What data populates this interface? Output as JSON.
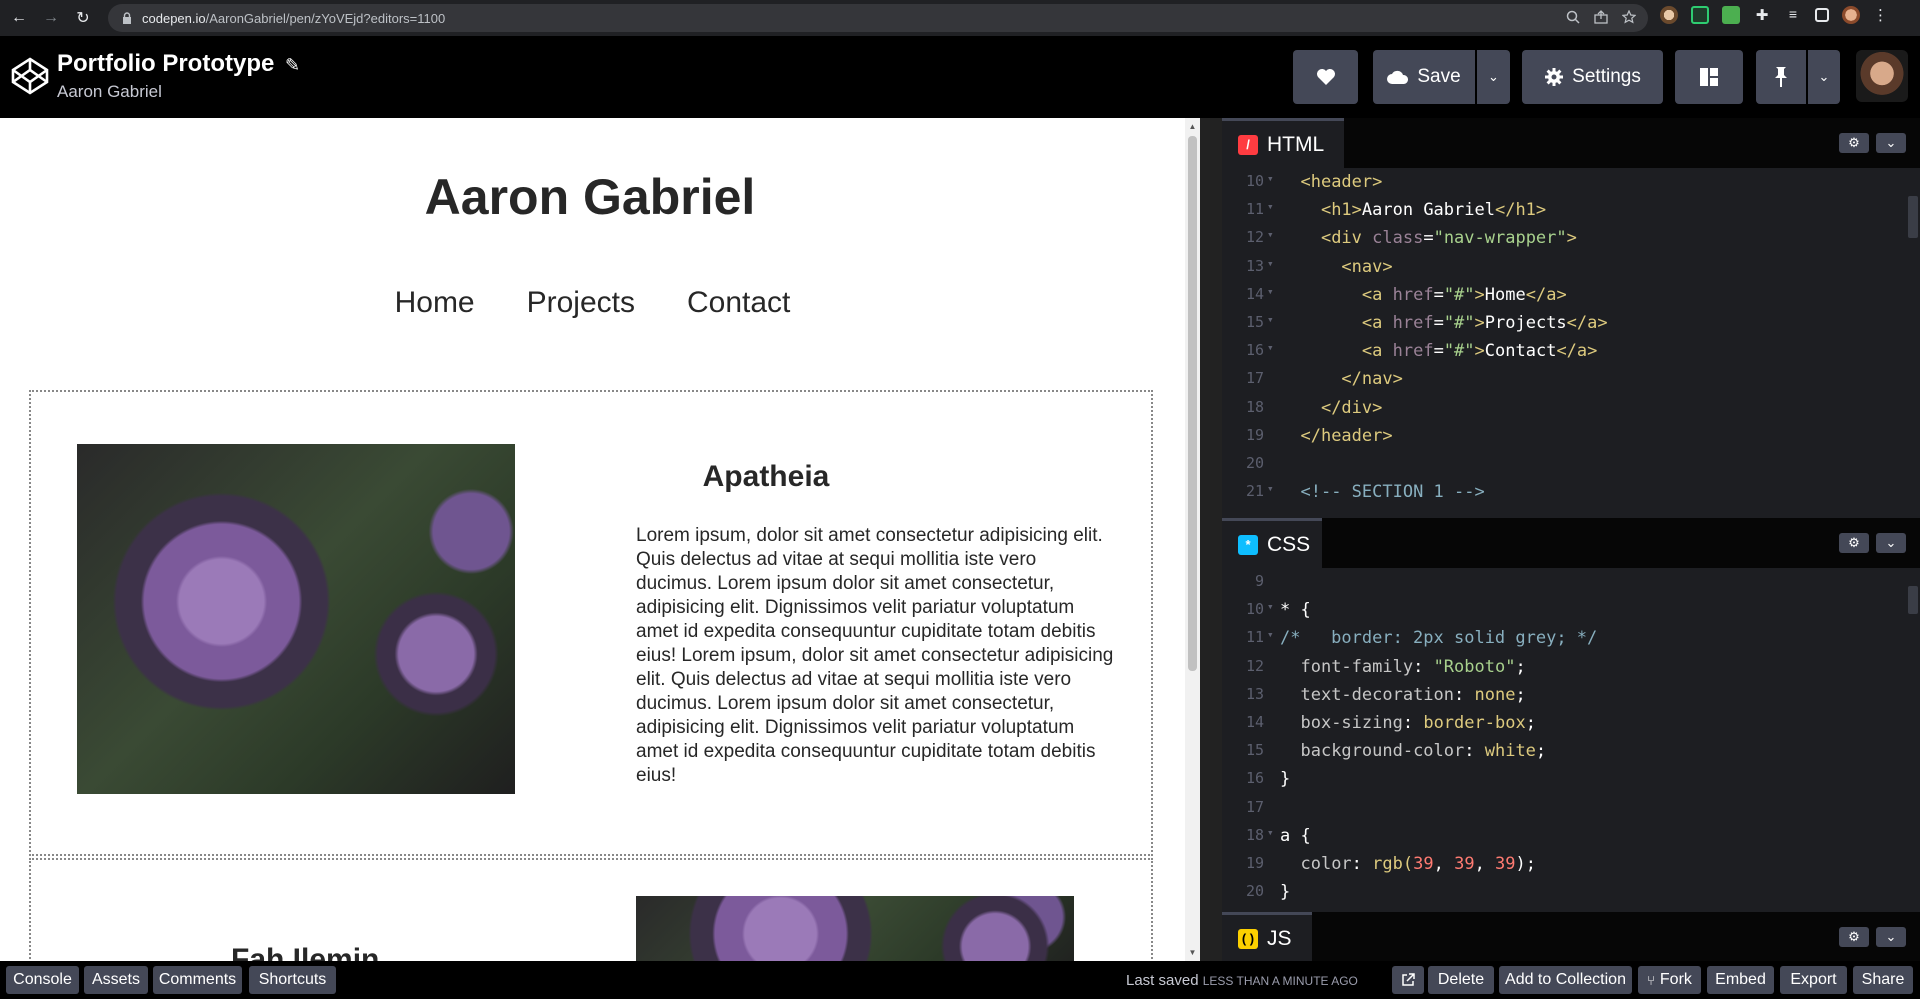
{
  "browser": {
    "url_host": "codepen.io",
    "url_path": "/AaronGabriel/pen/zYoVEjd?editors=1100",
    "back_icon": "←",
    "forward_icon": "→",
    "reload_icon": "↻"
  },
  "header": {
    "title": "Portfolio Prototype",
    "author": "Aaron Gabriel",
    "save_label": "Save",
    "settings_label": "Settings"
  },
  "preview": {
    "name": "Aaron Gabriel",
    "nav": [
      "Home",
      "Projects",
      "Contact"
    ],
    "section1": {
      "title": "Apatheia",
      "text": "Lorem ipsum, dolor sit amet consectetur adipisicing elit. Quis delectus ad vitae at sequi mollitia iste vero ducimus. Lorem ipsum dolor sit amet consectetur, adipisicing elit. Dignissimos velit pariatur voluptatum amet id expedita consequuntur cupiditate totam debitis eius! Lorem ipsum, dolor sit amet consectetur adipisicing elit. Quis delectus ad vitae at sequi mollitia iste vero ducimus. Lorem ipsum dolor sit amet consectetur, adipisicing elit. Dignissimos velit pariatur voluptatum amet id expedita consequuntur cupiditate totam debitis eius!"
    },
    "section2": {
      "title": "Fah Ilemin"
    }
  },
  "editors": {
    "html": {
      "label": "HTML",
      "badge": "/",
      "color": "#ff3c41"
    },
    "css": {
      "label": "CSS",
      "badge": "*",
      "color": "#0ebeff"
    },
    "js": {
      "label": "JS",
      "badge": "( )",
      "color": "#fcd000"
    }
  },
  "html_code": [
    {
      "n": "10",
      "fold": true,
      "parts": [
        [
          "  ",
          ""
        ],
        [
          "<header>",
          "c-tag"
        ]
      ]
    },
    {
      "n": "11",
      "fold": true,
      "parts": [
        [
          "    ",
          ""
        ],
        [
          "<h1>",
          "c-tag"
        ],
        [
          "Aaron Gabriel",
          ""
        ],
        [
          "</h1>",
          "c-tag"
        ]
      ]
    },
    {
      "n": "12",
      "fold": true,
      "parts": [
        [
          "    ",
          ""
        ],
        [
          "<div ",
          "c-tag"
        ],
        [
          "class",
          "c-attr"
        ],
        [
          "=",
          ""
        ],
        [
          "\"nav-wrapper\"",
          "c-str"
        ],
        [
          ">",
          "c-tag"
        ]
      ]
    },
    {
      "n": "13",
      "fold": true,
      "parts": [
        [
          "      ",
          ""
        ],
        [
          "<nav>",
          "c-tag"
        ]
      ]
    },
    {
      "n": "14",
      "fold": true,
      "parts": [
        [
          "        ",
          ""
        ],
        [
          "<a ",
          "c-tag"
        ],
        [
          "href",
          "c-attr"
        ],
        [
          "=",
          ""
        ],
        [
          "\"#\"",
          "c-str"
        ],
        [
          ">",
          "c-tag"
        ],
        [
          "Home",
          ""
        ],
        [
          "</a>",
          "c-tag"
        ]
      ]
    },
    {
      "n": "15",
      "fold": true,
      "parts": [
        [
          "        ",
          ""
        ],
        [
          "<a ",
          "c-tag"
        ],
        [
          "href",
          "c-attr"
        ],
        [
          "=",
          ""
        ],
        [
          "\"#\"",
          "c-str"
        ],
        [
          ">",
          "c-tag"
        ],
        [
          "Projects",
          ""
        ],
        [
          "</a>",
          "c-tag"
        ]
      ]
    },
    {
      "n": "16",
      "fold": true,
      "parts": [
        [
          "        ",
          ""
        ],
        [
          "<a ",
          "c-tag"
        ],
        [
          "href",
          "c-attr"
        ],
        [
          "=",
          ""
        ],
        [
          "\"#\"",
          "c-str"
        ],
        [
          ">",
          "c-tag"
        ],
        [
          "Contact",
          ""
        ],
        [
          "</a>",
          "c-tag"
        ]
      ]
    },
    {
      "n": "17",
      "fold": false,
      "parts": [
        [
          "      ",
          ""
        ],
        [
          "</nav>",
          "c-tag"
        ]
      ]
    },
    {
      "n": "18",
      "fold": false,
      "parts": [
        [
          "    ",
          ""
        ],
        [
          "</div>",
          "c-tag"
        ]
      ]
    },
    {
      "n": "19",
      "fold": false,
      "parts": [
        [
          "  ",
          ""
        ],
        [
          "</header>",
          "c-tag"
        ]
      ]
    },
    {
      "n": "20",
      "fold": false,
      "parts": []
    },
    {
      "n": "21",
      "fold": true,
      "parts": [
        [
          "  ",
          ""
        ],
        [
          "<!-- SECTION 1 -->",
          "c-cmt"
        ]
      ]
    }
  ],
  "css_code": [
    {
      "n": "9",
      "fold": false,
      "parts": []
    },
    {
      "n": "10",
      "fold": true,
      "parts": [
        [
          "* {",
          ""
        ]
      ]
    },
    {
      "n": "11",
      "fold": true,
      "parts": [
        [
          "/*   border: 2px solid grey; */",
          "c-cmt"
        ]
      ]
    },
    {
      "n": "12",
      "fold": false,
      "parts": [
        [
          "  ",
          ""
        ],
        [
          "font-family",
          "c-prop"
        ],
        [
          ": ",
          ""
        ],
        [
          "\"Roboto\"",
          "c-str"
        ],
        [
          ";",
          ""
        ]
      ]
    },
    {
      "n": "13",
      "fold": false,
      "parts": [
        [
          "  ",
          ""
        ],
        [
          "text-decoration",
          "c-prop"
        ],
        [
          ": ",
          ""
        ],
        [
          "none",
          "c-val"
        ],
        [
          ";",
          ""
        ]
      ]
    },
    {
      "n": "14",
      "fold": false,
      "parts": [
        [
          "  ",
          ""
        ],
        [
          "box-sizing",
          "c-prop"
        ],
        [
          ": ",
          ""
        ],
        [
          "border-box",
          "c-val"
        ],
        [
          ";",
          ""
        ]
      ]
    },
    {
      "n": "15",
      "fold": false,
      "parts": [
        [
          "  ",
          ""
        ],
        [
          "background-color",
          "c-prop"
        ],
        [
          ": ",
          ""
        ],
        [
          "white",
          "c-val"
        ],
        [
          ";",
          ""
        ]
      ]
    },
    {
      "n": "16",
      "fold": false,
      "parts": [
        [
          "}",
          ""
        ]
      ]
    },
    {
      "n": "17",
      "fold": false,
      "parts": []
    },
    {
      "n": "18",
      "fold": true,
      "parts": [
        [
          "a {",
          ""
        ]
      ]
    },
    {
      "n": "19",
      "fold": false,
      "parts": [
        [
          "  ",
          ""
        ],
        [
          "color",
          "c-prop"
        ],
        [
          ": ",
          ""
        ],
        [
          "rgb(",
          "c-val"
        ],
        [
          "39",
          "c-num"
        ],
        [
          ", ",
          ""
        ],
        [
          "39",
          "c-num"
        ],
        [
          ", ",
          ""
        ],
        [
          "39",
          "c-num"
        ],
        [
          ");",
          ""
        ]
      ]
    },
    {
      "n": "20",
      "fold": false,
      "parts": [
        [
          "}",
          ""
        ]
      ]
    }
  ],
  "footer": {
    "console": "Console",
    "assets": "Assets",
    "comments": "Comments",
    "shortcuts": "Shortcuts",
    "last_saved": "Last saved",
    "last_saved_time": "LESS THAN A MINUTE AGO",
    "delete": "Delete",
    "add_to_collection": "Add to Collection",
    "fork": "Fork",
    "embed": "Embed",
    "export": "Export",
    "share": "Share"
  }
}
